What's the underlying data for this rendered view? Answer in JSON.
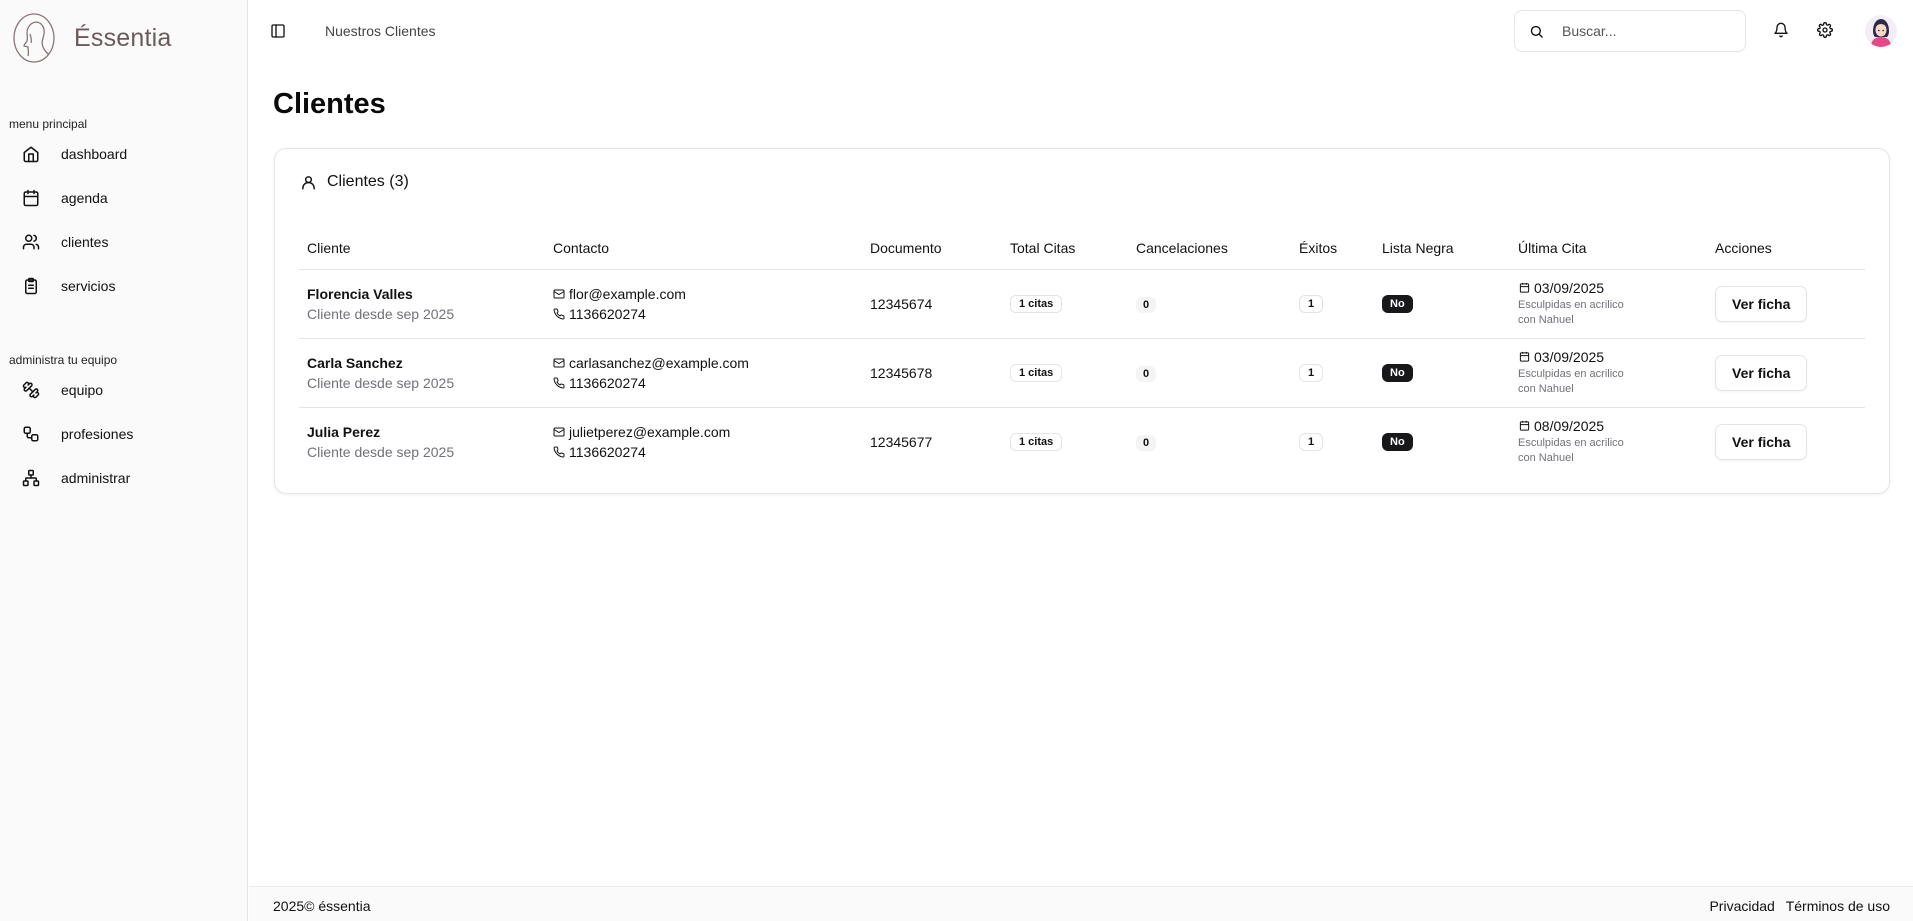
{
  "brand": {
    "name": "Éssentia"
  },
  "sidebar": {
    "groups": [
      {
        "label": "menu principal",
        "items": [
          {
            "label": "dashboard",
            "icon": "home-icon"
          },
          {
            "label": "agenda",
            "icon": "calendar-icon"
          },
          {
            "label": "clientes",
            "icon": "users-icon"
          },
          {
            "label": "servicios",
            "icon": "clipboard-icon"
          }
        ]
      },
      {
        "label": "administra tu equipo",
        "items": [
          {
            "label": "equipo",
            "icon": "dumbbell-icon"
          },
          {
            "label": "profesiones",
            "icon": "workflow-icon"
          },
          {
            "label": "administrar",
            "icon": "network-icon"
          }
        ]
      }
    ]
  },
  "header": {
    "breadcrumb": "Nuestros Clientes",
    "search_placeholder": "Buscar..."
  },
  "main": {
    "title": "Clientes",
    "card_title": "Clientes (3)",
    "columns": [
      "Cliente",
      "Contacto",
      "Documento",
      "Total Citas",
      "Cancelaciones",
      "Éxitos",
      "Lista Negra",
      "Última Cita",
      "Acciones"
    ],
    "rows": [
      {
        "name": "Florencia Valles",
        "since": "Cliente desde sep 2025",
        "email": "flor@example.com",
        "phone": "1136620274",
        "document": "12345674",
        "total": "1 citas",
        "cancel": "0",
        "exitos": "1",
        "blacklist": "No",
        "last_date": "03/09/2025",
        "last_desc": "Esculpidas en acrilico con Nahuel",
        "action": "Ver ficha"
      },
      {
        "name": "Carla Sanchez",
        "since": "Cliente desde sep 2025",
        "email": "carlasanchez@example.com",
        "phone": "1136620274",
        "document": "12345678",
        "total": "1 citas",
        "cancel": "0",
        "exitos": "1",
        "blacklist": "No",
        "last_date": "03/09/2025",
        "last_desc": "Esculpidas en acrilico con Nahuel",
        "action": "Ver ficha"
      },
      {
        "name": "Julia Perez",
        "since": "Cliente desde sep 2025",
        "email": "julietperez@example.com",
        "phone": "1136620274",
        "document": "12345677",
        "total": "1 citas",
        "cancel": "0",
        "exitos": "1",
        "blacklist": "No",
        "last_date": "08/09/2025",
        "last_desc": "Esculpidas en acrilico con Nahuel",
        "action": "Ver ficha"
      }
    ]
  },
  "footer": {
    "copyright": "2025© éssentia",
    "privacy": "Privacidad",
    "terms": "Términos de uso"
  },
  "colors": {
    "accent_dark": "#18181b",
    "brand_text": "#6b5a5a",
    "muted": "#71717a",
    "border": "#e4e4e7"
  }
}
